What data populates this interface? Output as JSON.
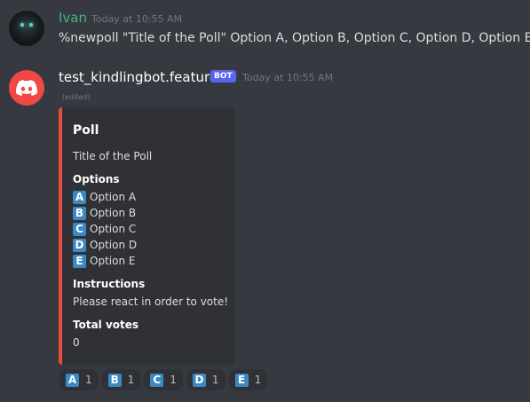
{
  "messages": [
    {
      "author": "Ivan",
      "author_color": "#43b581",
      "timestamp": "Today at 10:55 AM",
      "content": "%newpoll \"Title of the Poll\" Option A, Option B, Option C, Option D, Option E"
    },
    {
      "author": "test_kindlingbot.features",
      "author_color": "#ffffff",
      "bot_tag": "BOT",
      "timestamp": "Today at 10:55 AM",
      "edited": "(edited)",
      "embed": {
        "accent_color": "#e74c3c",
        "title": "Poll",
        "description": "Title of the Poll",
        "options_label": "Options",
        "options": [
          {
            "letter": "A",
            "label": "Option A"
          },
          {
            "letter": "B",
            "label": "Option B"
          },
          {
            "letter": "C",
            "label": "Option C"
          },
          {
            "letter": "D",
            "label": "Option D"
          },
          {
            "letter": "E",
            "label": "Option E"
          }
        ],
        "instructions_label": "Instructions",
        "instructions": "Please react in order to vote!",
        "total_votes_label": "Total votes",
        "total_votes": "0"
      },
      "reactions": [
        {
          "letter": "A",
          "count": "1"
        },
        {
          "letter": "B",
          "count": "1"
        },
        {
          "letter": "C",
          "count": "1"
        },
        {
          "letter": "D",
          "count": "1"
        },
        {
          "letter": "E",
          "count": "1"
        }
      ]
    }
  ]
}
